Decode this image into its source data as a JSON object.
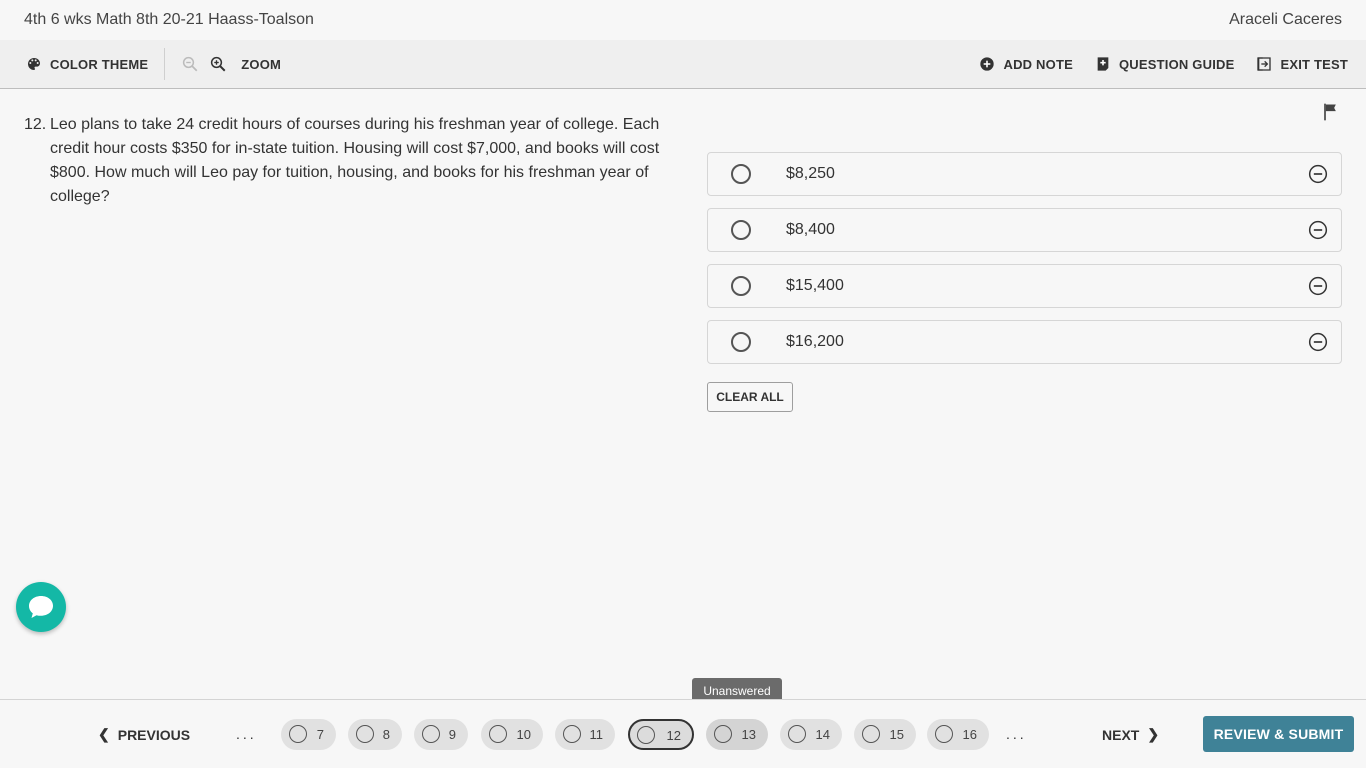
{
  "header": {
    "test_title": "4th 6 wks Math 8th 20-21 Haass-Toalson",
    "student_name": "Araceli Caceres"
  },
  "toolbar": {
    "color_theme_label": "COLOR THEME",
    "zoom_label": "ZOOM",
    "add_note_label": "ADD NOTE",
    "question_guide_label": "QUESTION GUIDE",
    "exit_test_label": "EXIT TEST",
    "icons": [
      "palette-icon",
      "zoom-out-icon",
      "zoom-in-icon",
      "add-circle-icon",
      "guide-icon",
      "exit-icon"
    ]
  },
  "question": {
    "number": "12.",
    "text": "Leo plans to take 24 credit hours of courses during his freshman year of college. Each credit hour costs $350 for in-state tuition. Housing will cost $7,000, and books will cost $800. How much will Leo pay for tuition, housing, and books for his freshman year of college?"
  },
  "answers": [
    {
      "text": "$8,250"
    },
    {
      "text": "$8,400"
    },
    {
      "text": "$15,400"
    },
    {
      "text": "$16,200"
    }
  ],
  "clear_all_label": "CLEAR ALL",
  "navigation": {
    "previous_label": "PREVIOUS",
    "next_label": "NEXT",
    "ellipsis": "...",
    "questions": [
      "7",
      "8",
      "9",
      "10",
      "11",
      "12",
      "13",
      "14",
      "15",
      "16"
    ],
    "current": "12",
    "tooltip": "Unanswered",
    "review_submit_label": "REVIEW & SUBMIT"
  },
  "colors": {
    "accent": "#3f8297",
    "chat": "#14b8a6",
    "tooltip": "#6b6b6b"
  }
}
